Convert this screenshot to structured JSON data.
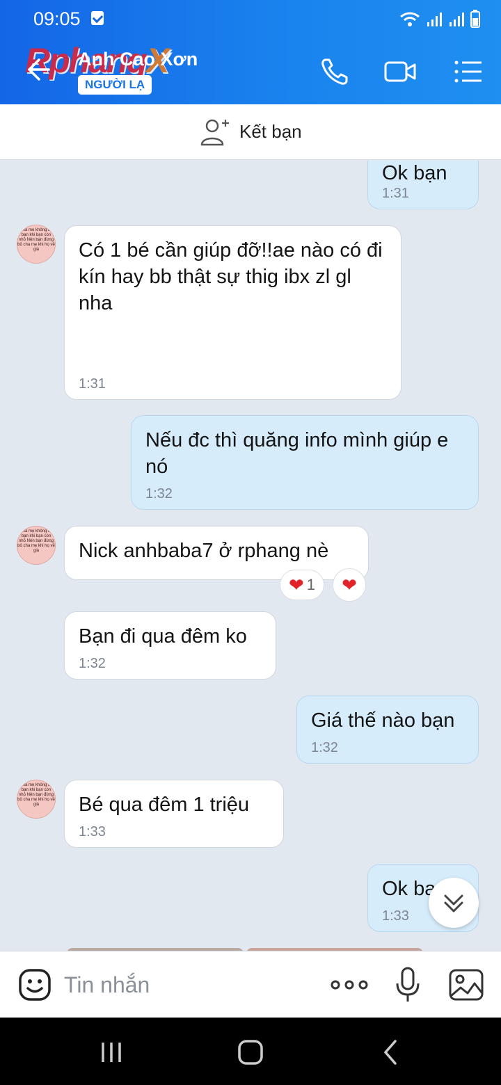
{
  "status": {
    "time": "09:05"
  },
  "header": {
    "contact_name": "Anh Cao Xơn",
    "badge": "NGƯỜI LẠ",
    "watermark_main": "Rphang",
    "watermark_x": "X",
    "icons": [
      "back-arrow-icon",
      "phone-icon",
      "video-camera-icon",
      "menu-list-icon"
    ]
  },
  "friend_bar": {
    "label": "Kết bạn",
    "icon": "add-friend-icon"
  },
  "avatar_text": "Cha mẹ không bỏ bạn khi bạn còn nhỏ Nên bạn đừng bỏ cha mẹ khi họ về già",
  "messages": [
    {
      "side": "out",
      "text": "Ok bạn",
      "time": "1:31"
    },
    {
      "side": "in",
      "text": "Có 1 bé cần giúp đỡ!!ae nào có đi kín hay bb thật sự thig ibx zl gl nha",
      "time": "1:31"
    },
    {
      "side": "out",
      "text": "Nếu đc thì quăng info mình giúp e nó",
      "time": "1:32"
    },
    {
      "side": "in",
      "text": "Nick anhbaba7 ở rphang nè",
      "time": "",
      "reaction_count": "1"
    },
    {
      "side": "in",
      "text": "Bạn đi qua đêm ko",
      "time": "1:32"
    },
    {
      "side": "out",
      "text": "Giá thế nào bạn",
      "time": "1:32"
    },
    {
      "side": "in",
      "text": "Bé qua đêm 1 triệu",
      "time": "1:33"
    },
    {
      "side": "out",
      "text": "Ok bạn",
      "time": "1:33"
    }
  ],
  "input": {
    "placeholder": "Tin nhắn"
  },
  "colors": {
    "header": "#1a7ae9",
    "bubble_out": "#d6ecfb",
    "bubble_in": "#ffffff",
    "chat_bg": "#e2e8f0",
    "heart": "#e3222a"
  }
}
